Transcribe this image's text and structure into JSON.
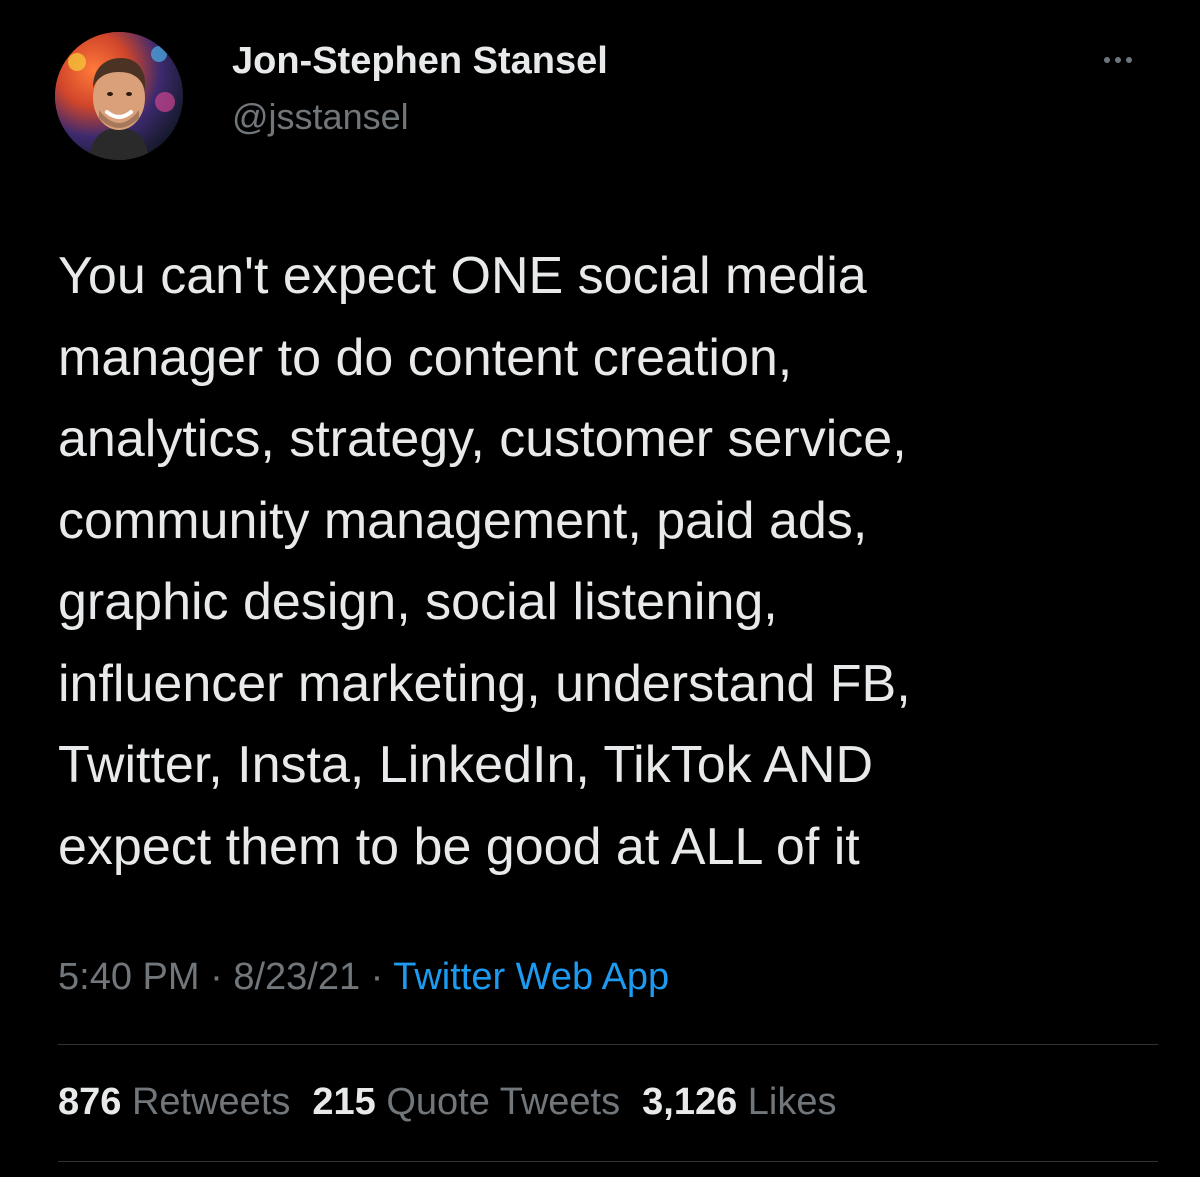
{
  "author": {
    "display_name": "Jon-Stephen Stansel",
    "handle": "@jsstansel"
  },
  "more_icon": "more-horizontal-icon",
  "tweet": {
    "lines": [
      "You can't expect ONE social media",
      "manager to do content creation,",
      "analytics, strategy, customer service,",
      "community management, paid ads,",
      "graphic design, social listening,",
      "influencer marketing, understand FB,",
      "Twitter, Insta, LinkedIn, TikTok AND",
      "expect them to be good at ALL of it"
    ]
  },
  "meta": {
    "time": "5:40 PM",
    "sep1": " · ",
    "date": "8/23/21",
    "sep2": " · ",
    "source": "Twitter Web App"
  },
  "stats": {
    "retweets_count": "876",
    "retweets_label": "Retweets",
    "quotes_count": "215",
    "quotes_label": "Quote Tweets",
    "likes_count": "3,126",
    "likes_label": "Likes"
  },
  "colors": {
    "background": "#000000",
    "text": "#e7e9ea",
    "secondary": "#71767b",
    "link": "#1d9bf0",
    "divider": "#2f3336"
  }
}
